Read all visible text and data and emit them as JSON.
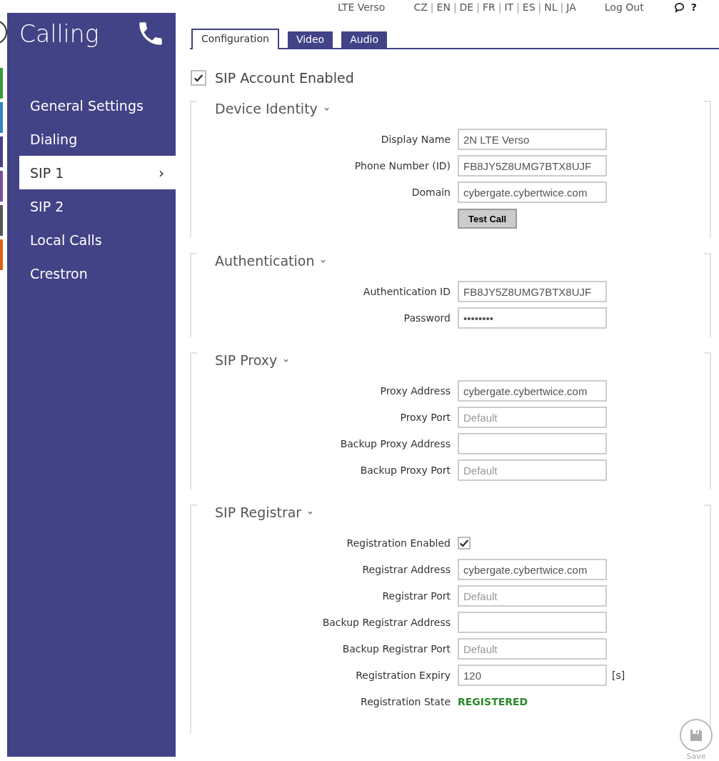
{
  "top_bar": {
    "device": "LTE Verso",
    "languages": [
      "CZ",
      "EN",
      "DE",
      "FR",
      "IT",
      "ES",
      "NL",
      "JA"
    ],
    "separator": "|",
    "logout": "Log Out",
    "help": "?"
  },
  "sidebar": {
    "title": "Calling",
    "items": [
      {
        "label": "General Settings",
        "selected": false
      },
      {
        "label": "Dialing",
        "selected": false
      },
      {
        "label": "SIP 1",
        "selected": true
      },
      {
        "label": "SIP 2",
        "selected": false
      },
      {
        "label": "Local Calls",
        "selected": false
      },
      {
        "label": "Crestron",
        "selected": false
      }
    ],
    "selected_marker": "›"
  },
  "tabs": [
    {
      "label": "Configuration",
      "selected": true
    },
    {
      "label": "Video",
      "selected": false
    },
    {
      "label": "Audio",
      "selected": false
    }
  ],
  "account": {
    "label": "SIP Account Enabled",
    "checked": true
  },
  "sections": [
    {
      "title": "Device Identity",
      "expanded": true,
      "fields": [
        {
          "kind": "text",
          "label": "Display Name",
          "value": "2N LTE Verso"
        },
        {
          "kind": "text",
          "label": "Phone Number (ID)",
          "value": "FB8JY5Z8UMG7BTX8UJF"
        },
        {
          "kind": "text",
          "label": "Domain",
          "value": "cybergate.cybertwice.com"
        },
        {
          "kind": "button",
          "label": "Test Call"
        }
      ]
    },
    {
      "title": "Authentication",
      "expanded": true,
      "fields": [
        {
          "kind": "text",
          "label": "Authentication ID",
          "value": "FB8JY5Z8UMG7BTX8UJF"
        },
        {
          "kind": "password",
          "label": "Password",
          "value": "••••••••"
        }
      ]
    },
    {
      "title": "SIP Proxy",
      "expanded": true,
      "fields": [
        {
          "kind": "text",
          "label": "Proxy Address",
          "value": "cybergate.cybertwice.com"
        },
        {
          "kind": "text",
          "label": "Proxy Port",
          "placeholder": "Default"
        },
        {
          "kind": "text",
          "label": "Backup Proxy Address"
        },
        {
          "kind": "text",
          "label": "Backup Proxy Port",
          "placeholder": "Default"
        }
      ]
    },
    {
      "title": "SIP Registrar",
      "expanded": true,
      "fields": [
        {
          "kind": "checkbox",
          "label": "Registration Enabled",
          "checked": true
        },
        {
          "kind": "text",
          "label": "Registrar Address",
          "value": "cybergate.cybertwice.com"
        },
        {
          "kind": "text",
          "label": "Registrar Port",
          "placeholder": "Default"
        },
        {
          "kind": "text",
          "label": "Backup Registrar Address"
        },
        {
          "kind": "text",
          "label": "Backup Registrar Port",
          "placeholder": "Default"
        },
        {
          "kind": "text",
          "label": "Registration Expiry",
          "value": "120",
          "unit": "[s]"
        },
        {
          "kind": "status",
          "label": "Registration State",
          "value": "REGISTERED"
        }
      ]
    }
  ],
  "save": {
    "label": "Save"
  }
}
